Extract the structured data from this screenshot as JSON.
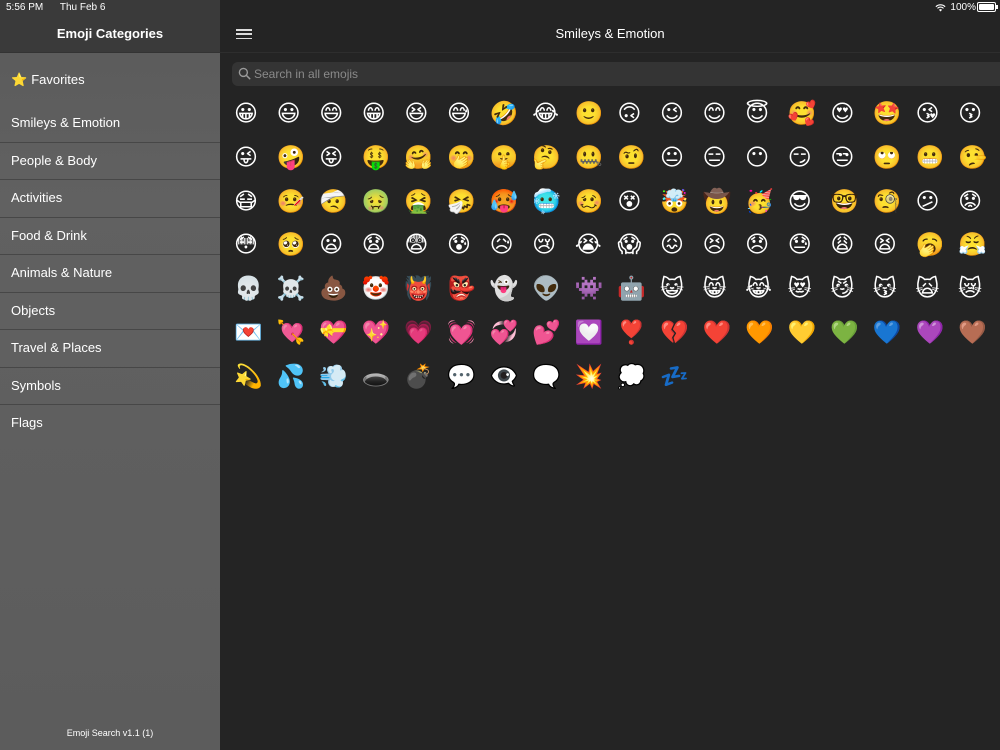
{
  "status_bar": {
    "time": "5:56 PM",
    "date": "Thu Feb 6",
    "battery": "100%"
  },
  "sidebar": {
    "title": "Emoji Categories",
    "favorites": {
      "icon": "⭐",
      "label": "Favorites"
    },
    "items": [
      {
        "label": "Smileys & Emotion"
      },
      {
        "label": "People & Body"
      },
      {
        "label": "Activities"
      },
      {
        "label": "Food & Drink"
      },
      {
        "label": "Animals & Nature"
      },
      {
        "label": "Objects"
      },
      {
        "label": "Travel & Places"
      },
      {
        "label": "Symbols"
      },
      {
        "label": "Flags"
      }
    ],
    "footer": "Emoji Search v1.1 (1)"
  },
  "main": {
    "title": "Smileys & Emotion",
    "search": {
      "placeholder": "Search in all emojis",
      "value": ""
    },
    "emojis": [
      "😀",
      "😃",
      "😄",
      "😁",
      "😆",
      "😅",
      "🤣",
      "😂",
      "🙂",
      "🙃",
      "😉",
      "😊",
      "😇",
      "🥰",
      "😍",
      "🤩",
      "😘",
      "😗",
      "😜",
      "🤪",
      "😝",
      "🤑",
      "🤗",
      "🤭",
      "🤫",
      "🤔",
      "🤐",
      "🤨",
      "😐",
      "😑",
      "😶",
      "😏",
      "😒",
      "🙄",
      "😬",
      "🤥",
      "😷",
      "🤒",
      "🤕",
      "🤢",
      "🤮",
      "🤧",
      "🥵",
      "🥶",
      "🥴",
      "😵",
      "🤯",
      "🤠",
      "🥳",
      "😎",
      "🤓",
      "🧐",
      "😕",
      "😟",
      "😳",
      "🥺",
      "😦",
      "😧",
      "😨",
      "😰",
      "😥",
      "😢",
      "😭",
      "😱",
      "😖",
      "😣",
      "😞",
      "😓",
      "😩",
      "😫",
      "🥱",
      "😤",
      "💀",
      "☠️",
      "💩",
      "🤡",
      "👹",
      "👺",
      "👻",
      "👽",
      "👾",
      "🤖",
      "😺",
      "😸",
      "😹",
      "😻",
      "😼",
      "😽",
      "🙀",
      "😿",
      "💌",
      "💘",
      "💝",
      "💖",
      "💗",
      "💓",
      "💞",
      "💕",
      "💟",
      "❣️",
      "💔",
      "❤️",
      "🧡",
      "💛",
      "💚",
      "💙",
      "💜",
      "🤎",
      "💫",
      "💦",
      "💨",
      "🕳️",
      "💣",
      "💬",
      "👁️‍🗨️",
      "🗨️",
      "💥",
      "💭",
      "💤"
    ]
  }
}
